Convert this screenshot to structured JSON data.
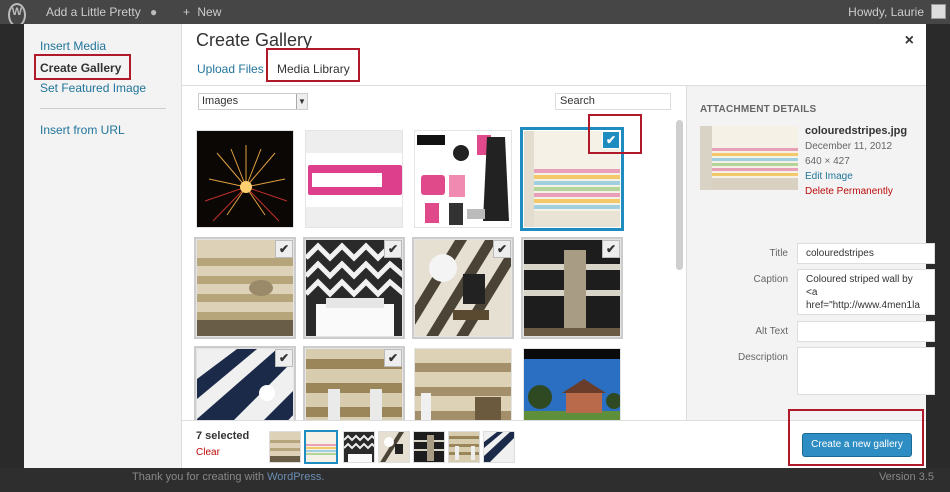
{
  "admin_bar": {
    "site_name": "Add a Little Pretty",
    "new_label": "New",
    "greeting": "Howdy, Laurie"
  },
  "menu": {
    "insert_media": "Insert Media",
    "create_gallery": "Create Gallery",
    "set_featured": "Set Featured Image",
    "insert_url": "Insert from URL"
  },
  "frame": {
    "title": "Create Gallery",
    "close": "×"
  },
  "tabs": {
    "upload": "Upload Files",
    "library": "Media Library"
  },
  "toolbar": {
    "filter_value": "Images",
    "search_placeholder": "Search"
  },
  "details": {
    "heading": "ATTACHMENT DETAILS",
    "filename": "colouredstripes.jpg",
    "date": "December 11, 2012",
    "dimensions": "640 × 427",
    "edit_link": "Edit Image",
    "delete_link": "Delete Permanently",
    "title_label": "Title",
    "title_value": "colouredstripes",
    "caption_label": "Caption",
    "caption_value": "Coloured striped wall by <a href=\"http://www.4men1la",
    "alt_label": "Alt Text",
    "description_label": "Description"
  },
  "bottom": {
    "selected_count": "7 selected",
    "clear": "Clear",
    "create_button": "Create a new gallery"
  },
  "footer": {
    "thanks_prefix": "Thank you for creating with ",
    "thanks_link": "WordPress.",
    "version": "Version 3.5"
  },
  "check_glyph": "✔"
}
